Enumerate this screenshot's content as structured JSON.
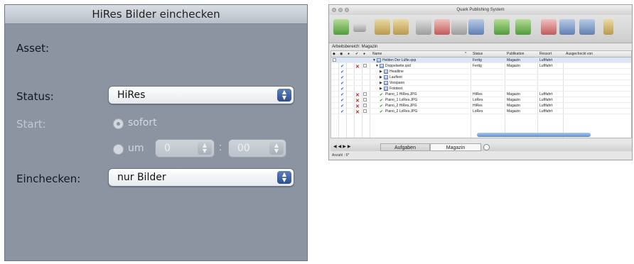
{
  "dialog": {
    "title": "HiRes Bilder einchecken",
    "asset_label": "Asset:",
    "status_label": "Status:",
    "status_value": "HiRes",
    "start_label": "Start:",
    "radio_now": "sofort",
    "radio_at": "um",
    "hour_value": "0",
    "minute_value": "00",
    "time_separator": ":",
    "checkin_label": "Einchecken:",
    "checkin_value": "nur Bilder"
  },
  "window": {
    "title": "Quark Publishing System",
    "workspace_label": "Arbeitsbereich: Magazin",
    "columns": [
      "Name",
      "Status",
      "Publikation",
      "Ressort",
      "Ausgecheckt von"
    ],
    "rows": [
      {
        "name": "Helden Der Lüfte.qxp",
        "status": "Fertig",
        "publication": "Magazin",
        "section": "Luftfahrt"
      },
      {
        "name": "Doppelseite.qxd",
        "status": "Fertig",
        "publication": "Magazin",
        "section": "Luftfahrt"
      },
      {
        "name": "Headline",
        "status": "",
        "publication": "",
        "section": ""
      },
      {
        "name": "Lauftext",
        "status": "",
        "publication": "",
        "section": ""
      },
      {
        "name": "Vorspann",
        "status": "",
        "publication": "",
        "section": ""
      },
      {
        "name": "Fototext",
        "status": "",
        "publication": "",
        "section": ""
      },
      {
        "name": "Piano_1 HiRes.JPG",
        "status": "HiRes",
        "publication": "Magazin",
        "section": "Luftfahrt"
      },
      {
        "name": "Piano_1 LoRes.JPG",
        "status": "LoRes",
        "publication": "Magazin",
        "section": "Luftfahrt"
      },
      {
        "name": "Piano_2 HiRes.JPG",
        "status": "HiRes",
        "publication": "Magazin",
        "section": "Luftfahrt"
      },
      {
        "name": "Piano_2 LoRes.JPG",
        "status": "LoRes",
        "publication": "Magazin",
        "section": "Luftfahrt"
      }
    ],
    "tabs": [
      "Aufgaben",
      "Magazin"
    ],
    "status_text": "Anzahl : 6*"
  }
}
